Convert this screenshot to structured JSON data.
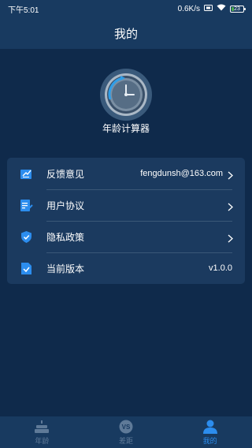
{
  "status_bar": {
    "time": "下午5:01",
    "network_speed": "0.6K/s",
    "battery_level": "23",
    "battery_color": "#4caf50"
  },
  "nav": {
    "title": "我的"
  },
  "app": {
    "name": "年龄计算器"
  },
  "menu": {
    "items": [
      {
        "icon": "feedback-icon",
        "label": "反馈意见",
        "value": "fengdunsh@163.com",
        "has_arrow": true
      },
      {
        "icon": "user-agreement-icon",
        "label": "用户协议",
        "value": "",
        "has_arrow": true
      },
      {
        "icon": "privacy-shield-icon",
        "label": "隐私政策",
        "value": "",
        "has_arrow": true
      },
      {
        "icon": "version-icon",
        "label": "当前版本",
        "value": "v1.0.0",
        "has_arrow": false
      }
    ]
  },
  "tabbar": {
    "tabs": [
      {
        "icon": "cake-icon",
        "label": "年龄",
        "active": false
      },
      {
        "icon": "vs-icon",
        "label": "差距",
        "active": false
      },
      {
        "icon": "person-icon",
        "label": "我的",
        "active": true
      }
    ]
  },
  "colors": {
    "background": "#0f2a4b",
    "bar": "#183a60",
    "card": "#1b3a5f",
    "accent": "#2c8dee",
    "inactive_tab": "#5f7a98"
  }
}
